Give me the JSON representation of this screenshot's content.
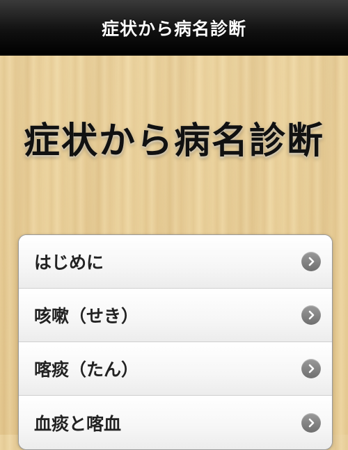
{
  "header": {
    "title": "症状から病名診断"
  },
  "hero": {
    "title": "症状から病名診断"
  },
  "menu": {
    "items": [
      {
        "label": "はじめに"
      },
      {
        "label": "咳嗽（せき）"
      },
      {
        "label": "喀痰（たん）"
      },
      {
        "label": "血痰と喀血"
      }
    ]
  },
  "icons": {
    "row_arrow": "chevron-right-icon"
  },
  "colors": {
    "header_bg": "#111111",
    "wood": "#e8cf98",
    "chevron": "#7a7a7a"
  }
}
